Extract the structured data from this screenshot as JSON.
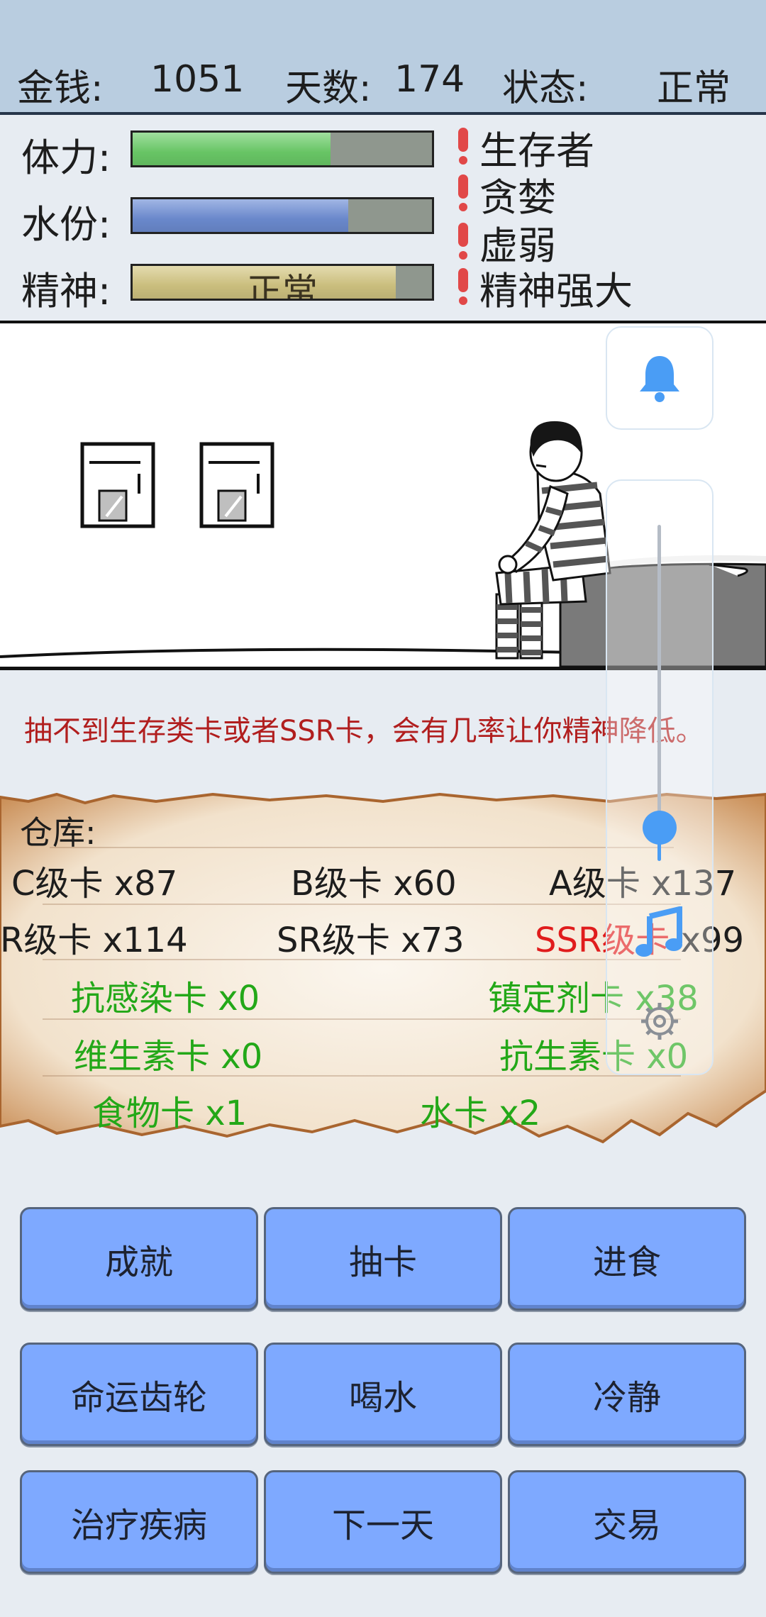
{
  "header": {
    "money_label": "金钱:",
    "money_value": "1051",
    "days_label": "天数:",
    "days_value": "174",
    "status_label": "状态:",
    "status_value": "正常"
  },
  "stats": {
    "stamina": {
      "label": "体力:",
      "fraction": 0.66,
      "color": "#6dcf6a"
    },
    "water": {
      "label": "水份:",
      "fraction": 0.72,
      "color": "#6f8fd6"
    },
    "spirit": {
      "label": "精神:",
      "fraction": 0.88,
      "color": "#d5c884",
      "text": "正常"
    }
  },
  "traits": [
    "生存者",
    "贪婪",
    "虚弱",
    "精神强大"
  ],
  "message": "抽不到生存类卡或者SSR卡，会有几率让你精神降低。",
  "warehouse": {
    "title": "仓库:",
    "cards": {
      "c": "C级卡 x87",
      "b": "B级卡 x60",
      "a": "A级卡 x137",
      "r": "R级卡 x114",
      "sr": "SR级卡 x73",
      "ssr_label": "SSR级卡",
      "ssr_count": "x99",
      "anti_infection": "抗感染卡 x0",
      "sedative": "镇定剂卡 x38",
      "vitamin": "维生素卡 x0",
      "antibiotic": "抗生素卡 x0",
      "food": "食物卡 x1",
      "water": "水卡 x2"
    },
    "colors": {
      "normal": "#1d1d1d",
      "green": "#23a818",
      "red": "#e01c1c"
    }
  },
  "side_panel": {
    "bell_icon": "bell-icon",
    "music_icon": "music-note-icon",
    "settings_icon": "gear-icon",
    "volume_level": 0.1
  },
  "buttons": [
    "成就",
    "抽卡",
    "进食",
    "命运齿轮",
    "喝水",
    "冷静",
    "治疗疾病",
    "下一天",
    "交易"
  ]
}
